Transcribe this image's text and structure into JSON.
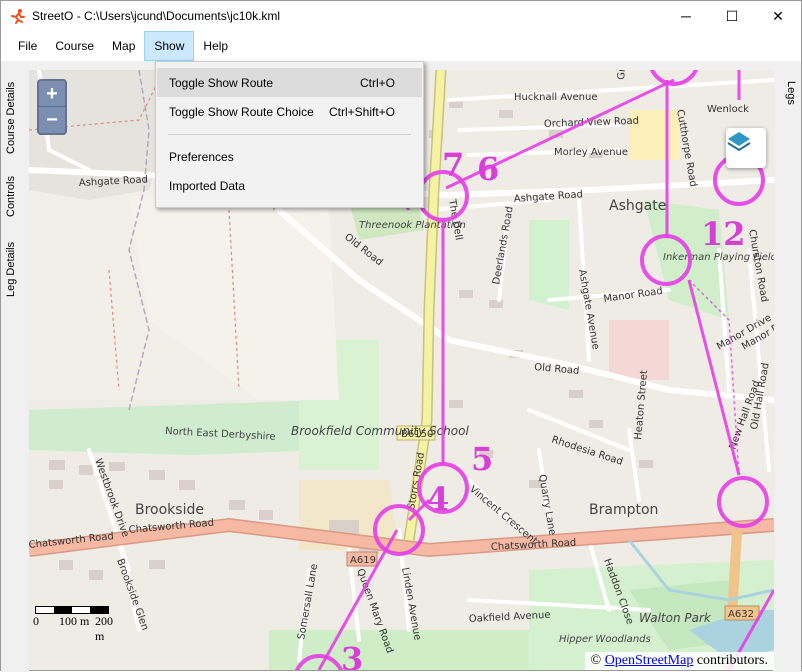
{
  "titlebar": {
    "app_name": "StreetO",
    "separator": " - ",
    "file_path": "C:\\Users\\jcund\\Documents\\jc10k.kml",
    "minimize": "─",
    "maximize": "☐",
    "close": "✕"
  },
  "menubar": {
    "items": [
      {
        "label": "File"
      },
      {
        "label": "Course"
      },
      {
        "label": "Map"
      },
      {
        "label": "Show"
      },
      {
        "label": "Help"
      }
    ]
  },
  "show_menu": {
    "items": [
      {
        "label": "Toggle Show Route",
        "shortcut": "Ctrl+O"
      },
      {
        "label": "Toggle Show Route Choice",
        "shortcut": "Ctrl+Shift+O"
      },
      {
        "label": "Preferences",
        "shortcut": ""
      },
      {
        "label": "Imported Data",
        "shortcut": ""
      }
    ]
  },
  "left_tabs": [
    "Course Details",
    "Controls",
    "Leg Details"
  ],
  "right_tabs": [
    "Legs"
  ],
  "map": {
    "zoom_in": "+",
    "zoom_out": "−",
    "attribution_prefix": "© ",
    "attribution_link": "OpenStreetMap",
    "attribution_suffix": " contributors.",
    "scale_labels": [
      "0",
      "100 m",
      "200 m"
    ],
    "road_labels": [
      "Ashgate Road",
      "Old Road",
      "Chatsworth Road",
      "Storrs Road",
      "Hucknall Avenue",
      "Orchard View Road",
      "Morley Avenue",
      "Deerlands Road",
      "Ashgate Avenue",
      "Manor Road",
      "Manor Drive",
      "Old Hall Road",
      "New Hall Road",
      "Rhodesia Road",
      "Vincent Crescent",
      "Quarry Lane",
      "Linden Avenue",
      "Queen Mary Road",
      "Somersall Lane",
      "Westbrook Drive",
      "Brookside Glen",
      "Haddon Close",
      "Oakfield Avenue",
      "Greenbank Drive",
      "Cutthorpe Road",
      "Churston Road",
      "The Dell",
      "Heaton Street",
      "Wenlock"
    ],
    "road_refs": [
      "B6150",
      "A619",
      "A632"
    ],
    "place_labels": [
      "Ashgate",
      "Brookside",
      "Brampton",
      "Brookfield Community School",
      "North East Derbyshire",
      "Threenook Plantation",
      "Inkerman Playing Fields",
      "Walton Park",
      "Hipper Woodlands"
    ],
    "controls": [
      "3",
      "4",
      "5",
      "6",
      "7",
      "12"
    ],
    "accent_color": "#e63ee6"
  }
}
